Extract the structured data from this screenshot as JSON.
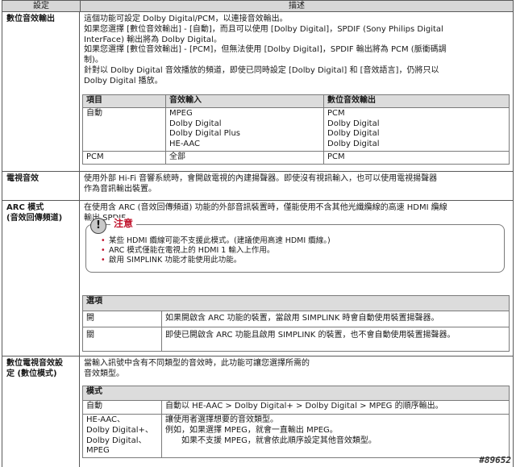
{
  "header": {
    "setting": "設定",
    "description": "描述"
  },
  "rows": [
    {
      "setting": "數位音效輸出",
      "lines": [
        "這個功能可設定 Dolby Digital/PCM，以連接音效輸出。",
        "如果您選擇 [數位音效輸出] - [自動]，而且可以使用 [Dolby Digital]，SPDIF (Sony Philips Digital",
        "InterFace) 輸出將為 Dolby Digital。",
        "如果您選擇 [數位音效輸出] - [PCM]，但無法使用 [Dolby Digital]，SPDIF 輸出將為 PCM (脈衝碼調",
        "制)。",
        "針對以 Dolby Digital 音效播放的頻道，即使已同時設定 [Dolby Digital] 和 [音效語言]，仍將只以",
        "Dolby Digital 播放。"
      ],
      "table": {
        "headers": [
          "項目",
          "音效輸入",
          "數位音效輸出"
        ],
        "r1": {
          "item": "自動",
          "inputs": [
            "MPEG",
            "Dolby Digital",
            "Dolby Digital Plus",
            "HE-AAC"
          ],
          "outputs": [
            "PCM",
            "Dolby Digital",
            "Dolby Digital",
            "Dolby Digital"
          ]
        },
        "r2": {
          "item": "PCM",
          "input": "全部",
          "output": "PCM"
        }
      }
    },
    {
      "setting": "電視音效",
      "lines": [
        "使用外部 Hi-Fi 音響系統時，會開啟電視的內建揚聲器。即使沒有視訊輸入，也可以使用電視揚聲器",
        "作為音訊輸出裝置。"
      ]
    },
    {
      "setting_lines": [
        "ARC 模式",
        "(音效回傳頻道)"
      ],
      "lines": [
        "在使用含 ARC (音效回傳頻道) 功能的外部音訊裝置時，僅能使用不含其他光纖纜線的高速 HDMI 纜線",
        "輸出 SPDIF。"
      ],
      "notice": {
        "badge": "!",
        "title": "注意",
        "items": [
          "某些 HDMI 纜線可能不支援此模式。(建議使用高速 HDMI 纜線。)",
          "ARC 模式僅能在電視上的 HDMI 1 輸入上作用。",
          "啟用 SIMPLINK 功能才能使用此功能。"
        ]
      },
      "table": {
        "header": "選項",
        "r1": {
          "opt": "開",
          "desc": "如果開啟含 ARC 功能的裝置，當啟用 SIMPLINK 時會自動使用裝置揚聲器。"
        },
        "r2": {
          "opt": "關",
          "desc": "即使已開啟含 ARC 功能且啟用 SIMPLINK 的裝置，也不會自動使用裝置揚聲器。"
        }
      }
    },
    {
      "setting_lines": [
        "數位電視音效設",
        "定 (數位模式)"
      ],
      "lines": [
        "當輸入訊號中含有不同類型的音效時，此功能可讓您選擇所需的",
        "音效類型。"
      ],
      "table": {
        "header": "模式",
        "r1": {
          "mode": "自動",
          "desc": "自動以 HE-AAC > Dolby Digital+ > Dolby Digital > MPEG 的順序輸出。"
        },
        "r2": {
          "mode_lines": [
            "HE-AAC、",
            "Dolby Digital+、",
            "Dolby Digital、",
            "MPEG"
          ],
          "desc_lines": [
            "讓使用者選擇想要的音效類型。",
            "例如，如果選擇 MPEG，就會一直輸出 MPEG。",
            "如果不支援 MPEG，就會依此順序設定其他音效類型。"
          ]
        }
      }
    }
  ],
  "watermark": "#89652"
}
